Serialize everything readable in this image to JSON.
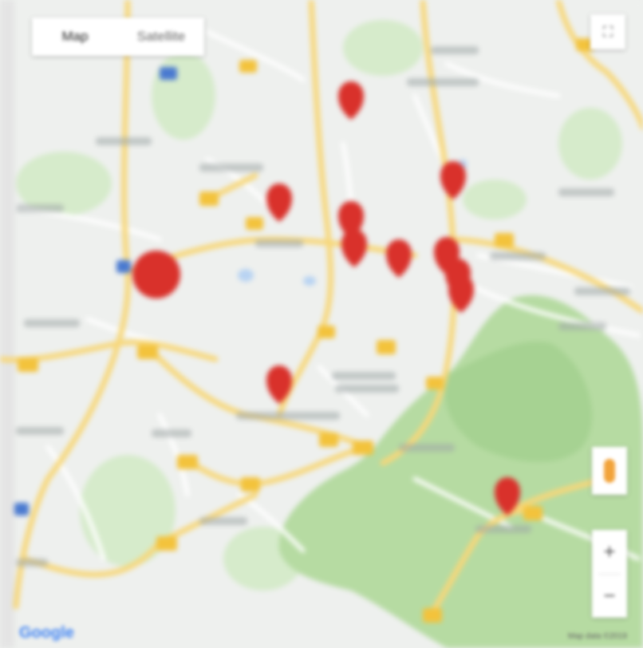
{
  "map": {
    "type_control": {
      "map_label": "Map",
      "satellite_label": "Satellite",
      "selected": "Map"
    },
    "fullscreen_icon": "fullscreen-icon",
    "pegman_icon": "street-view-pegman-icon",
    "zoom": {
      "in_label": "+",
      "out_label": "−"
    },
    "logo_text": "Google",
    "attribution": "Map data ©2019",
    "colors": {
      "land": "#eef0ee",
      "park": "#c9e4b4",
      "forest": "#a8d497",
      "road_major": "#f9d77a",
      "road_minor": "#ffffff",
      "marker": "#d9312b",
      "shield": "#f5c842",
      "water": "#a8c8f0"
    },
    "marker_count": 12
  }
}
